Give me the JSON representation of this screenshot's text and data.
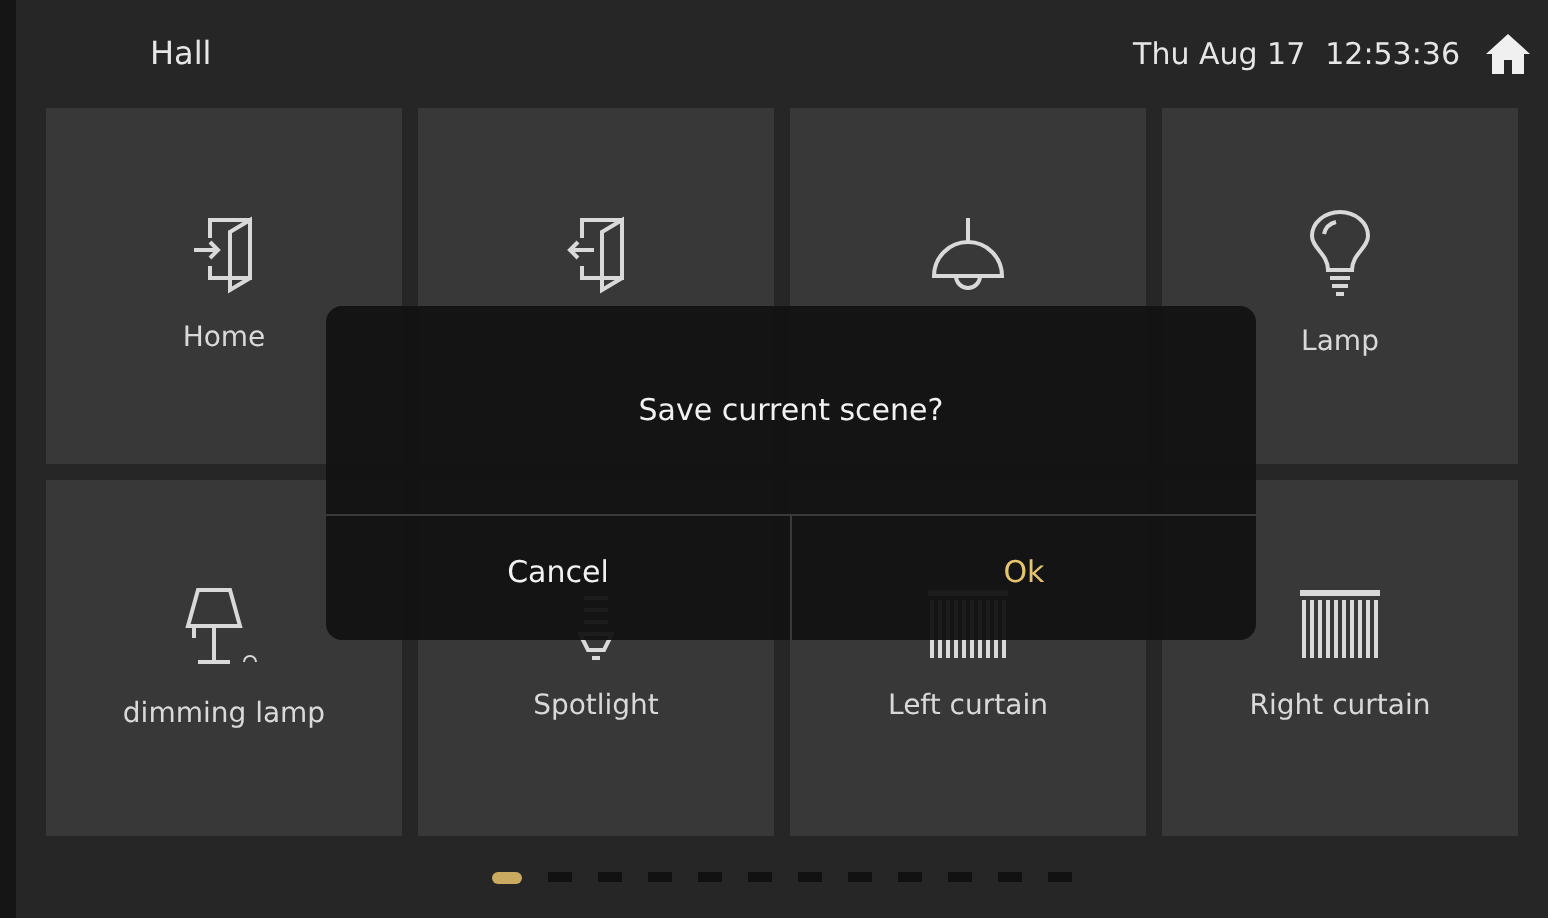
{
  "header": {
    "room": "Hall",
    "date": "Thu Aug 17",
    "time": "12:53:36"
  },
  "tiles": [
    {
      "kind": "door-in",
      "label": "Home"
    },
    {
      "kind": "door-out"
    },
    {
      "kind": "pendant"
    },
    {
      "kind": "bulb",
      "label": "Lamp"
    },
    {
      "kind": "table-lamp",
      "label": "dimming lamp"
    },
    {
      "kind": "spotlight",
      "label": "Spotlight"
    },
    {
      "kind": "curtain",
      "label": "Left curtain"
    },
    {
      "kind": "curtain",
      "label": "Right curtain"
    }
  ],
  "dialog": {
    "message": "Save current scene?",
    "buttons": [
      {
        "label": "Cancel",
        "kind": "cancel"
      },
      {
        "label": "Ok",
        "kind": "confirm"
      }
    ]
  },
  "pages": [
    {
      "selected": true
    },
    {
      "selected": false
    },
    {
      "selected": false
    },
    {
      "selected": false
    },
    {
      "selected": false
    },
    {
      "selected": false
    },
    {
      "selected": false
    },
    {
      "selected": false
    },
    {
      "selected": false
    },
    {
      "selected": false
    },
    {
      "selected": false
    },
    {
      "selected": false
    }
  ]
}
